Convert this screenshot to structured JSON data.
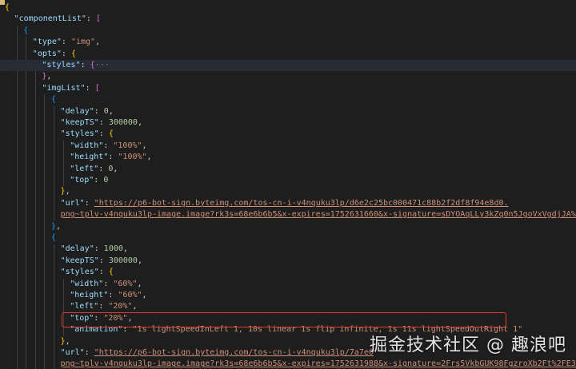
{
  "editor": {
    "lines": [
      {
        "indent": 0,
        "tokens": [
          {
            "c": "b1",
            "t": "{"
          }
        ]
      },
      {
        "indent": 1,
        "tokens": [
          {
            "c": "k",
            "t": "\"componentList\""
          },
          {
            "c": "p",
            "t": ": "
          },
          {
            "c": "b2",
            "t": "["
          }
        ]
      },
      {
        "indent": 2,
        "tokens": [
          {
            "c": "b3",
            "t": "{"
          }
        ]
      },
      {
        "indent": 3,
        "tokens": [
          {
            "c": "k",
            "t": "\"type\""
          },
          {
            "c": "p",
            "t": ": "
          },
          {
            "c": "s",
            "t": "\"img\""
          },
          {
            "c": "p",
            "t": ","
          }
        ]
      },
      {
        "indent": 3,
        "tokens": [
          {
            "c": "k",
            "t": "\"opts\""
          },
          {
            "c": "p",
            "t": ": "
          },
          {
            "c": "b1",
            "t": "{"
          }
        ]
      },
      {
        "indent": 4,
        "highlight": true,
        "tokens": [
          {
            "c": "k",
            "t": "\"styles\""
          },
          {
            "c": "p",
            "t": ": "
          },
          {
            "c": "b2",
            "t": "{"
          },
          {
            "c": "fold",
            "t": "···"
          }
        ]
      },
      {
        "indent": 4,
        "tokens": [
          {
            "c": "b2",
            "t": "}"
          },
          {
            "c": "p",
            "t": ","
          }
        ]
      },
      {
        "indent": 4,
        "tokens": [
          {
            "c": "k",
            "t": "\"imgList\""
          },
          {
            "c": "p",
            "t": ": "
          },
          {
            "c": "b2",
            "t": "["
          }
        ]
      },
      {
        "indent": 5,
        "tokens": [
          {
            "c": "b3",
            "t": "{"
          }
        ]
      },
      {
        "indent": 6,
        "tokens": [
          {
            "c": "k",
            "t": "\"delay\""
          },
          {
            "c": "p",
            "t": ": "
          },
          {
            "c": "n",
            "t": "0"
          },
          {
            "c": "p",
            "t": ","
          }
        ]
      },
      {
        "indent": 6,
        "tokens": [
          {
            "c": "k",
            "t": "\"keepTS\""
          },
          {
            "c": "p",
            "t": ": "
          },
          {
            "c": "n",
            "t": "300000"
          },
          {
            "c": "p",
            "t": ","
          }
        ]
      },
      {
        "indent": 6,
        "tokens": [
          {
            "c": "k",
            "t": "\"styles\""
          },
          {
            "c": "p",
            "t": ": "
          },
          {
            "c": "b1",
            "t": "{"
          }
        ]
      },
      {
        "indent": 7,
        "tokens": [
          {
            "c": "k",
            "t": "\"width\""
          },
          {
            "c": "p",
            "t": ": "
          },
          {
            "c": "s",
            "t": "\"100%\""
          },
          {
            "c": "p",
            "t": ","
          }
        ]
      },
      {
        "indent": 7,
        "tokens": [
          {
            "c": "k",
            "t": "\"height\""
          },
          {
            "c": "p",
            "t": ": "
          },
          {
            "c": "s",
            "t": "\"100%\""
          },
          {
            "c": "p",
            "t": ","
          }
        ]
      },
      {
        "indent": 7,
        "tokens": [
          {
            "c": "k",
            "t": "\"left\""
          },
          {
            "c": "p",
            "t": ": "
          },
          {
            "c": "n",
            "t": "0"
          },
          {
            "c": "p",
            "t": ","
          }
        ]
      },
      {
        "indent": 7,
        "tokens": [
          {
            "c": "k",
            "t": "\"top\""
          },
          {
            "c": "p",
            "t": ": "
          },
          {
            "c": "n",
            "t": "0"
          }
        ]
      },
      {
        "indent": 6,
        "tokens": [
          {
            "c": "b1",
            "t": "}"
          },
          {
            "c": "p",
            "t": ","
          }
        ]
      },
      {
        "indent": 6,
        "tokens": [
          {
            "c": "k",
            "t": "\"url\""
          },
          {
            "c": "p",
            "t": ": "
          },
          {
            "c": "link",
            "t": "\"https://p6-bot-sign.byteimg.com/tos-cn-i-v4nquku3lp/d6e2c25bc000471c88b2f2df8f94e8d0."
          }
        ]
      },
      {
        "indent": 6,
        "tokens": [
          {
            "c": "link",
            "t": "png~tplv-v4nquku3lp-image.image?rk3s=68e6b6b5&x-expires=1752631660&x-signature=sDYOAqLLy3kZq0n5JgoVxVgdjJA%3D\""
          }
        ]
      },
      {
        "indent": 5,
        "tokens": [
          {
            "c": "b3",
            "t": "}"
          },
          {
            "c": "p",
            "t": ","
          }
        ]
      },
      {
        "indent": 5,
        "tokens": [
          {
            "c": "b3",
            "t": "{"
          }
        ]
      },
      {
        "indent": 6,
        "tokens": [
          {
            "c": "k",
            "t": "\"delay\""
          },
          {
            "c": "p",
            "t": ": "
          },
          {
            "c": "n",
            "t": "1000"
          },
          {
            "c": "p",
            "t": ","
          }
        ]
      },
      {
        "indent": 6,
        "tokens": [
          {
            "c": "k",
            "t": "\"keepTS\""
          },
          {
            "c": "p",
            "t": ": "
          },
          {
            "c": "n",
            "t": "300000"
          },
          {
            "c": "p",
            "t": ","
          }
        ]
      },
      {
        "indent": 6,
        "tokens": [
          {
            "c": "k",
            "t": "\"styles\""
          },
          {
            "c": "p",
            "t": ": "
          },
          {
            "c": "b1",
            "t": "{"
          }
        ]
      },
      {
        "indent": 7,
        "tokens": [
          {
            "c": "k",
            "t": "\"width\""
          },
          {
            "c": "p",
            "t": ": "
          },
          {
            "c": "s",
            "t": "\"60%\""
          },
          {
            "c": "p",
            "t": ","
          }
        ]
      },
      {
        "indent": 7,
        "tokens": [
          {
            "c": "k",
            "t": "\"height\""
          },
          {
            "c": "p",
            "t": ": "
          },
          {
            "c": "s",
            "t": "\"60%\""
          },
          {
            "c": "p",
            "t": ","
          }
        ]
      },
      {
        "indent": 7,
        "tokens": [
          {
            "c": "k",
            "t": "\"left\""
          },
          {
            "c": "p",
            "t": ": "
          },
          {
            "c": "s",
            "t": "\"20%\""
          },
          {
            "c": "p",
            "t": ","
          }
        ]
      },
      {
        "indent": 7,
        "tokens": [
          {
            "c": "k",
            "t": "\"top\""
          },
          {
            "c": "p",
            "t": ": "
          },
          {
            "c": "s",
            "t": "\"20%\""
          },
          {
            "c": "p",
            "t": ","
          }
        ]
      },
      {
        "indent": 7,
        "tokens": [
          {
            "c": "k",
            "t": "\"animation\""
          },
          {
            "c": "p",
            "t": ": "
          },
          {
            "c": "s",
            "t": "\"1s lightSpeedInLeft 1, 10s linear 1s flip infinite, 1s 11s lightSpeedOutRight 1\""
          }
        ]
      },
      {
        "indent": 6,
        "tokens": [
          {
            "c": "b1",
            "t": "}"
          },
          {
            "c": "p",
            "t": ","
          }
        ]
      },
      {
        "indent": 6,
        "tokens": [
          {
            "c": "k",
            "t": "\"url\""
          },
          {
            "c": "p",
            "t": ": "
          },
          {
            "c": "link",
            "t": "\"https://p6-bot-sign.byteimg.com/tos-cn-i-v4nquku3lp/7a7e0"
          }
        ]
      },
      {
        "indent": 6,
        "tokens": [
          {
            "c": "link",
            "t": "png~tplv-v4nquku3lp-image.image?rk3s=68e6b6b5&x-expires=1752631988&x-signature=2Frs5VkbGUK98FgzroXb2Ft%2FE3Q%3D\""
          }
        ]
      },
      {
        "indent": 5,
        "tokens": [
          {
            "c": "b3",
            "t": "}"
          }
        ]
      }
    ]
  },
  "watermark": {
    "text": "掘金技术社区 @ 趣浪吧"
  }
}
